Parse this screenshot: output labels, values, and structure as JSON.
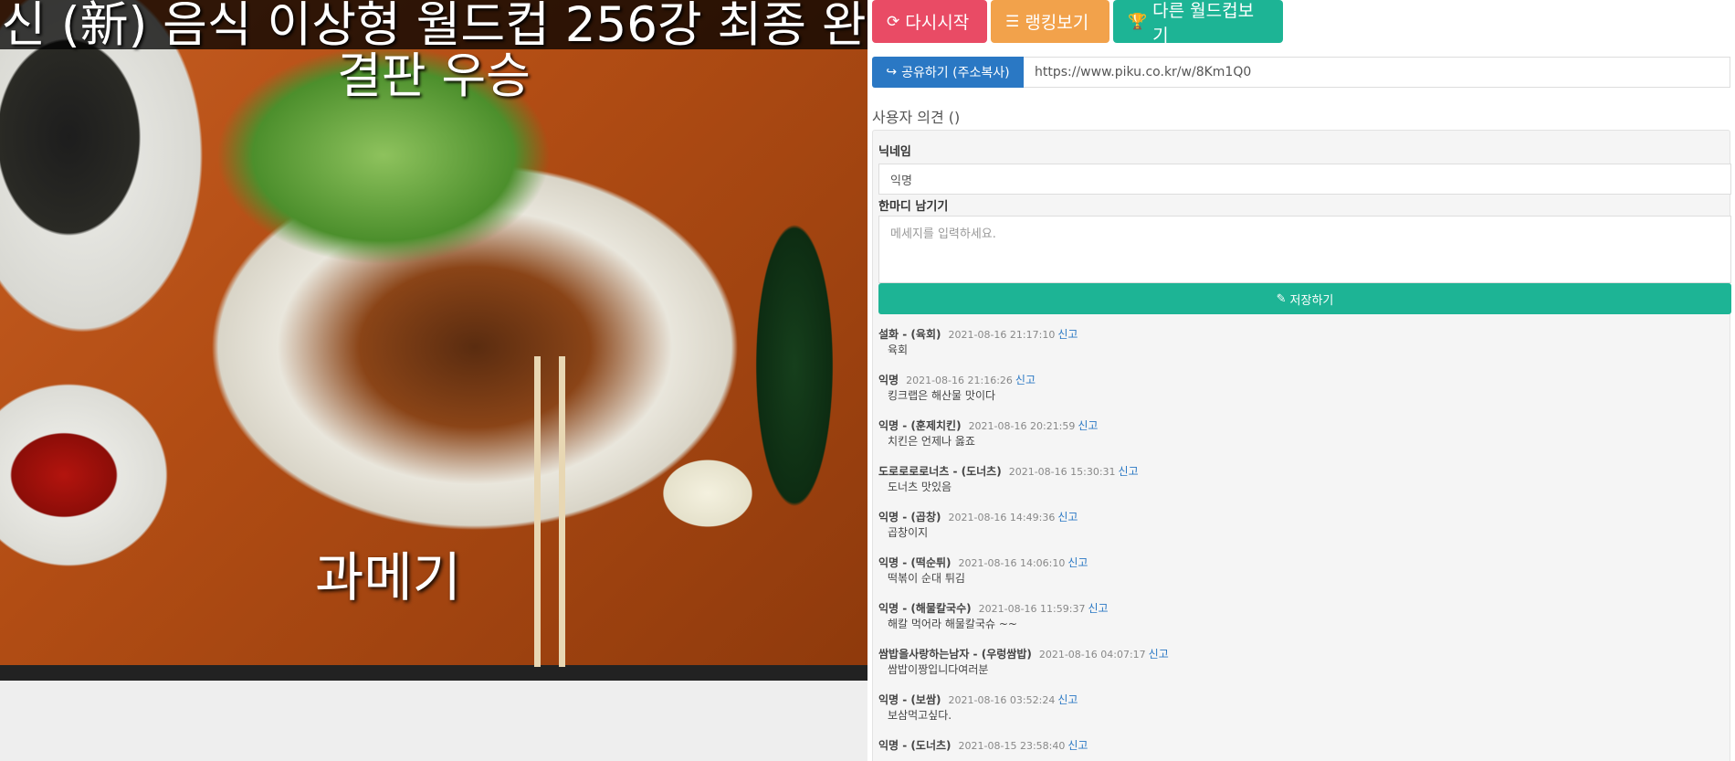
{
  "game": {
    "title": "신 (新) 음식 이상형 월드컵 256강 최종 완결판   우승",
    "item_name": "과메기"
  },
  "buttons": {
    "restart": {
      "icon": "refresh-icon",
      "label": "다시시작"
    },
    "ranking": {
      "icon": "list-icon",
      "label": "랭킹보기"
    },
    "other": {
      "icon": "trophy-icon",
      "label": "다른 월드컵보기"
    }
  },
  "share": {
    "icon": "share-icon",
    "label": "공유하기 (주소복사)",
    "url": "https://www.piku.co.kr/w/8Km1Q0"
  },
  "opinions": {
    "title": "사용자 의견 ()",
    "nickname_label": "닉네임",
    "nickname_value": "익명",
    "message_label": "한마디 남기기",
    "message_placeholder": "메세지를 입력하세요.",
    "save_icon": "pencil-icon",
    "save_label": "저장하기",
    "report_label": "신고"
  },
  "comments": [
    {
      "nick": "설화",
      "choice": " - (육회)",
      "date": "2021-08-16 21:17:10",
      "text": "육회"
    },
    {
      "nick": "익명",
      "choice": "",
      "date": "2021-08-16 21:16:26",
      "text": "킹크랩은 해산물 맛이다"
    },
    {
      "nick": "익명",
      "choice": " - (훈제치킨)",
      "date": "2021-08-16 20:21:59",
      "text": "치킨은 언제나 옳죠"
    },
    {
      "nick": "도로로로로너츠",
      "choice": " - (도너츠)",
      "date": "2021-08-16 15:30:31",
      "text": "도너츠 맛있음"
    },
    {
      "nick": "익명",
      "choice": " - (곱창)",
      "date": "2021-08-16 14:49:36",
      "text": "곱창이지"
    },
    {
      "nick": "익명",
      "choice": " - (떡순튀)",
      "date": "2021-08-16 14:06:10",
      "text": "떡볶이 순대 튀김"
    },
    {
      "nick": "익명",
      "choice": " - (해물칼국수)",
      "date": "2021-08-16 11:59:37",
      "text": "해칼 먹어라 해물칼국슈 ~~"
    },
    {
      "nick": "쌈밥을사랑하는남자",
      "choice": " - (우렁쌈밥)",
      "date": "2021-08-16 04:07:17",
      "text": "쌈밥이짱입니다여러분"
    },
    {
      "nick": "익명",
      "choice": " - (보쌈)",
      "date": "2021-08-16 03:52:24",
      "text": "보삼먹고싶다."
    },
    {
      "nick": "익명",
      "choice": " - (도너츠)",
      "date": "2021-08-15 23:58:40",
      "text": ""
    }
  ]
}
